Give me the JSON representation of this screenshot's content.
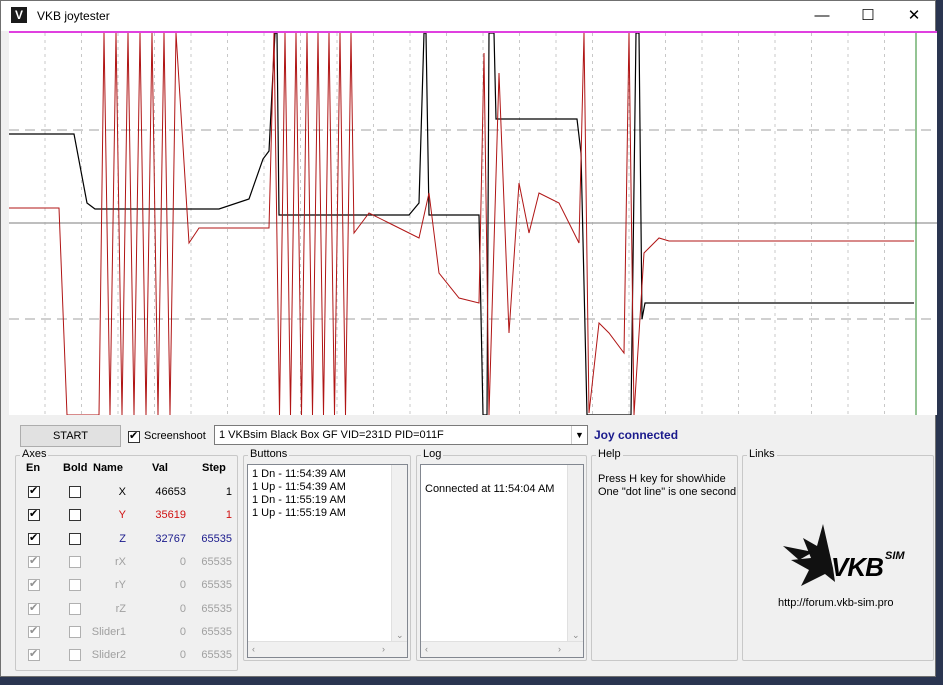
{
  "window": {
    "title": "VKB joytester",
    "icon": "vkb-app-icon",
    "controls": {
      "minimize": "—",
      "maximize": "☐",
      "close": "✕"
    }
  },
  "colors": {
    "plot_border": "#e040e0",
    "series_red": "#b01515",
    "series_black": "#000000",
    "connected_text": "#1a1a8c",
    "z_text": "#1a1a8c",
    "y_text": "#d01010"
  },
  "toolbar": {
    "start_label": "START",
    "screenshoot_label": "Screenshoot",
    "screenshoot_checked": true,
    "device_select_value": "1 VKBsim Black Box GF  VID=231D PID=011F",
    "status_text": "Joy connected"
  },
  "axes": {
    "group_label": "Axes",
    "headers": {
      "en": "En",
      "bold": "Bold",
      "name": "Name",
      "val": "Val",
      "step": "Step"
    },
    "rows": [
      {
        "name": "X",
        "val": "46653",
        "step": "1",
        "enabled": true,
        "bold": false,
        "active": true,
        "color": "#000000"
      },
      {
        "name": "Y",
        "val": "35619",
        "step": "1",
        "enabled": true,
        "bold": false,
        "active": true,
        "color": "#d01010"
      },
      {
        "name": "Z",
        "val": "32767",
        "step": "65535",
        "enabled": true,
        "bold": false,
        "active": true,
        "color": "#1a1a8c"
      },
      {
        "name": "rX",
        "val": "0",
        "step": "65535",
        "enabled": true,
        "bold": false,
        "active": false,
        "color": "#a0a0a0"
      },
      {
        "name": "rY",
        "val": "0",
        "step": "65535",
        "enabled": true,
        "bold": false,
        "active": false,
        "color": "#a0a0a0"
      },
      {
        "name": "rZ",
        "val": "0",
        "step": "65535",
        "enabled": true,
        "bold": false,
        "active": false,
        "color": "#a0a0a0"
      },
      {
        "name": "Slider1",
        "val": "0",
        "step": "65535",
        "enabled": true,
        "bold": false,
        "active": false,
        "color": "#a0a0a0"
      },
      {
        "name": "Slider2",
        "val": "0",
        "step": "65535",
        "enabled": true,
        "bold": false,
        "active": false,
        "color": "#a0a0a0"
      }
    ]
  },
  "buttons_panel": {
    "group_label": "Buttons",
    "entries": [
      "1 Dn - 11:54:39 AM",
      "1 Up - 11:54:39 AM",
      "1 Dn - 11:55:19 AM",
      "1 Up - 11:55:19 AM"
    ]
  },
  "log_panel": {
    "group_label": "Log",
    "entries": [
      "Connected at 11:54:04 AM"
    ]
  },
  "help_panel": {
    "group_label": "Help",
    "line1": "Press H key for show\\hide",
    "line2": "One \"dot line\" is one second"
  },
  "links_panel": {
    "group_label": "Links",
    "logo_text": "VKB",
    "logo_suffix": "SIM",
    "url": "http://forum.vkb-sim.pro"
  }
}
